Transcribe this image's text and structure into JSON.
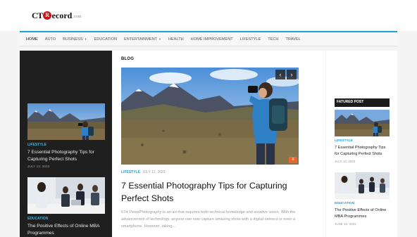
{
  "logo": {
    "lead": "CT",
    "circle": "R",
    "rest": "ecord",
    "domain": ".com"
  },
  "nav": [
    {
      "label": "HOME",
      "active": true,
      "dropdown": false
    },
    {
      "label": "AUTO",
      "active": false,
      "dropdown": false
    },
    {
      "label": "BUSINESS",
      "active": false,
      "dropdown": true
    },
    {
      "label": "EDUCATION",
      "active": false,
      "dropdown": false
    },
    {
      "label": "ENTERTAINMENT",
      "active": false,
      "dropdown": true
    },
    {
      "label": "HEALTH",
      "active": false,
      "dropdown": false
    },
    {
      "label": "HOME IMPROVEMENT",
      "active": false,
      "dropdown": false
    },
    {
      "label": "LIFESTYLE",
      "active": false,
      "dropdown": false
    },
    {
      "label": "TECH",
      "active": false,
      "dropdown": false
    },
    {
      "label": "TRAVEL",
      "active": false,
      "dropdown": false
    }
  ],
  "left": {
    "cards": [
      {
        "category": "LIFESTYLE",
        "title": "7 Essential Photography Tips for Capturing Perfect Shots",
        "date": "JULY 12, 2023",
        "image": "photographer-mountains"
      },
      {
        "category": "EDUCATION",
        "title": "The Positive Effects of Online MBA Programmes",
        "date": "",
        "image": "business-meeting"
      }
    ]
  },
  "main": {
    "section_label": "BLOG",
    "hero_image": "photographer-mountains",
    "prev_icon": "chevron-left-icon",
    "next_icon": "chevron-right-icon",
    "comment_count": "0",
    "category": "LIFESTYLE",
    "date": "JULY 12, 2023",
    "title": "7 Essential Photography Tips for Capturing Perfect Shots",
    "excerpt": "674 ViewsPhotography is an art that requires both technical knowledge and creative vision. With the advancement of technology, anyone can now capture amazing shots with a digital camera or even a smartphone. However, taking..."
  },
  "right": {
    "featured_label": "FATURED POST",
    "cards": [
      {
        "category": "LIFESTYLE",
        "title": "7 Essential Photography Tips for Capturing Perfect Shots",
        "date": "JULY 12, 2023",
        "image": "photographer-mountains"
      },
      {
        "category": "EDUCATION",
        "title": "The Positive Effects of Online MBA Programmes",
        "date": "JUNE 16, 2023",
        "image": "business-meeting"
      }
    ]
  },
  "colors": {
    "accent": "#1aa3d9",
    "logo_red": "#c4161c",
    "dark_panel": "#1f1f1f",
    "badge": "#e8652c"
  }
}
